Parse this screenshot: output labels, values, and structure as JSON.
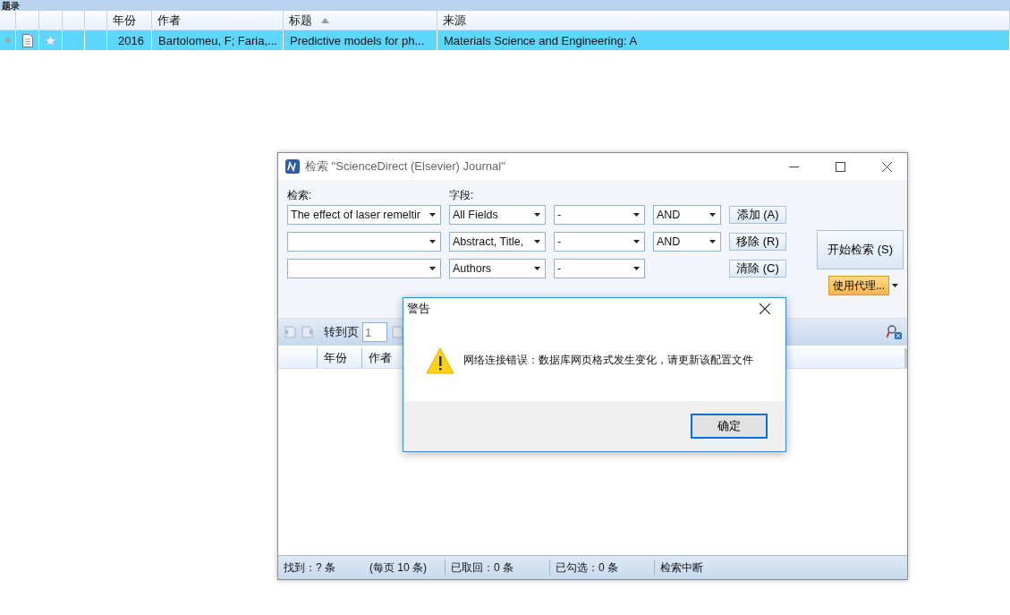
{
  "main_list": {
    "title": "题录",
    "columns": [
      {},
      {},
      {},
      {},
      {},
      {
        "label": "年份"
      },
      {
        "label": "作者"
      },
      {
        "label": "标题",
        "sorted": true
      },
      {
        "label": "来源"
      }
    ],
    "rows": [
      {
        "selected": true,
        "year": "2016",
        "author": "Bartolomeu, F; Faria,...",
        "title": "Predictive models for ph...",
        "source": "Materials Science and Engineering: A"
      }
    ]
  },
  "search_window": {
    "title": "检索 \"ScienceDirect (Elsevier) Journal\"",
    "search_label": "检索:",
    "field_label": "字段:",
    "rows": [
      {
        "term": "The effect of laser remeltir",
        "field": "All Fields",
        "condition": "-",
        "operator": "AND",
        "button": "添加 (A)"
      },
      {
        "field": "Abstract, Title,",
        "condition": "-",
        "operator": "AND",
        "button": "移除 (R)"
      },
      {
        "field": "Authors",
        "condition": "-",
        "button": "清除 (C)"
      }
    ],
    "start_button": "开始检索 (S)",
    "proxy_button": "使用代理...",
    "toolbar": {
      "goto_label": "转到页",
      "page": "1"
    },
    "columns": [
      "年份",
      "作者"
    ],
    "status_bar": [
      "找到：? 条",
      "(每页 10 条)",
      "已取回：0 条",
      "已勾选：0 条",
      "检索中断"
    ]
  },
  "alert": {
    "title": "警告",
    "message": "网络连接错误：数据库网页格式发生变化，请更新该配置文件",
    "ok_button": "确定"
  }
}
